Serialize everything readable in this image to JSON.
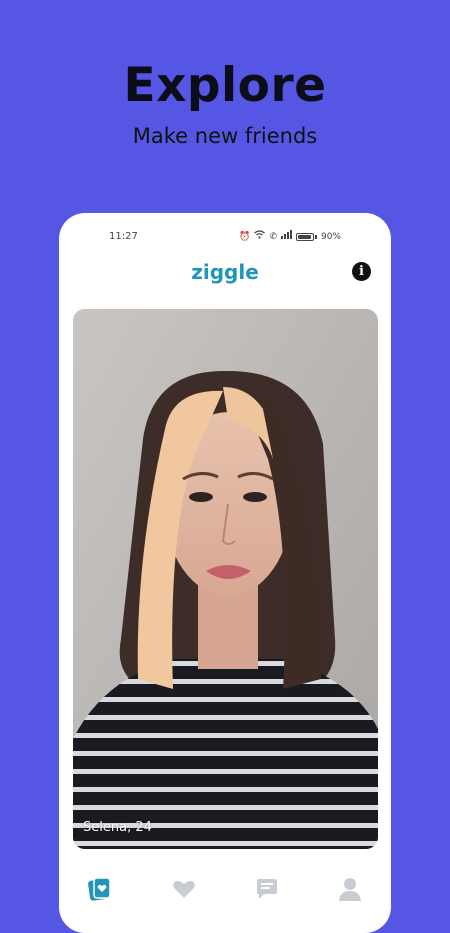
{
  "promo": {
    "title": "Explore",
    "subtitle": "Make new friends"
  },
  "status_bar": {
    "time": "11:27",
    "battery": "90%",
    "battery_level": 0.9
  },
  "app": {
    "title": "ziggle",
    "info_icon": "info-icon"
  },
  "card": {
    "label": "Selena, 24"
  },
  "tabbar": {
    "tabs": [
      {
        "icon": "cards-heart-icon",
        "active": true,
        "color": "#2296b8"
      },
      {
        "icon": "heart-icon",
        "active": false,
        "color": "#c8ccd3"
      },
      {
        "icon": "chat-icon",
        "active": false,
        "color": "#c8ccd3"
      },
      {
        "icon": "profile-icon",
        "active": false,
        "color": "#c8ccd3"
      }
    ]
  },
  "colors": {
    "background": "#5557e4",
    "accent": "#2296b8",
    "card_bg": "#ffffff"
  }
}
